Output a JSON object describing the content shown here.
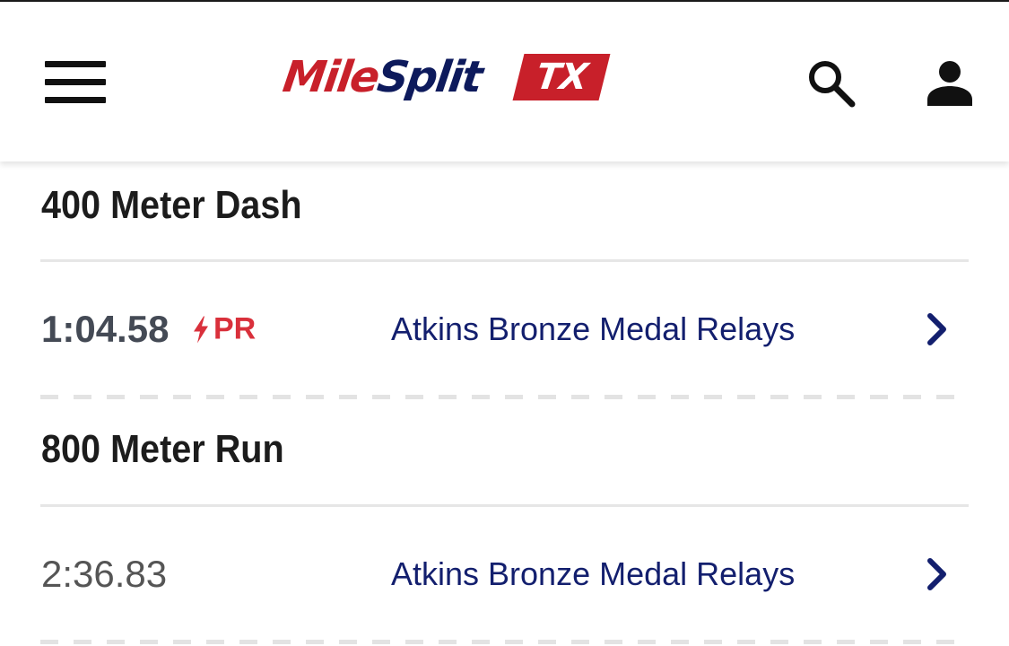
{
  "header": {
    "logo": {
      "part1": "Mile",
      "part2": "Split",
      "state": "TX"
    },
    "icons": {
      "menu": "hamburger-menu-icon",
      "search": "search-icon",
      "account": "user-icon"
    }
  },
  "events": [
    {
      "title": "400 Meter Dash",
      "results": [
        {
          "mark": "1:04.58",
          "pr": true,
          "pr_label": "PR",
          "meet": "Atkins Bronze Medal Relays"
        }
      ]
    },
    {
      "title": "800 Meter Run",
      "results": [
        {
          "mark": "2:36.83",
          "pr": false,
          "meet": "Atkins Bronze Medal Relays"
        }
      ]
    }
  ],
  "colors": {
    "brand_red": "#c8202a",
    "brand_navy": "#0d1a5c",
    "link": "#131f6e",
    "pr": "#d9303b"
  }
}
